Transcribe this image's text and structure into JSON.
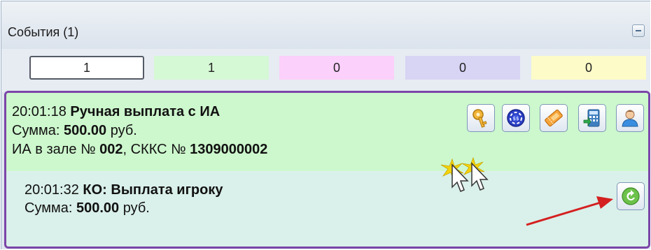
{
  "header": {
    "title": "События (1)"
  },
  "counters": [
    "1",
    "1",
    "0",
    "0",
    "0"
  ],
  "event1": {
    "time": "20:01:18",
    "title": "Ручная выплата с ИА",
    "sum_label": "Сумма:",
    "sum_value": "500.00",
    "sum_unit": "руб.",
    "location_label": "ИА в зале №",
    "machine_no": "002",
    "skks_label": ", СККС №",
    "skks_no": "1309000002"
  },
  "event2": {
    "time": "20:01:32",
    "title": "КО: Выплата игроку",
    "sum_label": "Сумма:",
    "sum_value": "500.00",
    "sum_unit": "руб."
  },
  "icons": [
    "key-icon",
    "casino-chip-icon",
    "ticket-icon",
    "calculator-icon",
    "user-icon",
    "undo-icon"
  ],
  "colors": {
    "border_accent": "#7b45a8",
    "event1_bg": "#cdf7cd",
    "event2_bg": "#daf0ea",
    "arrow": "#d42020"
  }
}
